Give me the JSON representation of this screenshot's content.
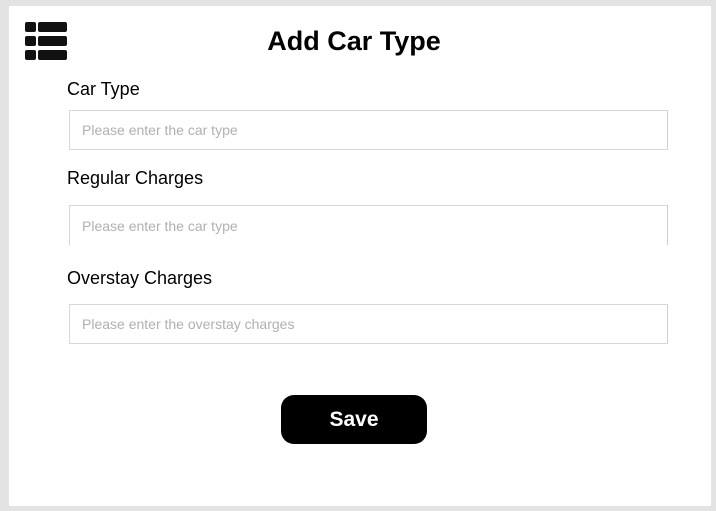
{
  "header": {
    "title": "Add Car Type",
    "menu_icon": "list-menu-icon"
  },
  "form": {
    "car_type": {
      "label": "Car Type",
      "value": "",
      "placeholder": "Please enter the car type"
    },
    "regular_charges": {
      "label": "Regular Charges",
      "value": "",
      "placeholder": "Please enter the car type"
    },
    "overstay_charges": {
      "label": "Overstay Charges",
      "value": "",
      "placeholder": "Please enter the overstay charges"
    },
    "save_label": "Save"
  }
}
